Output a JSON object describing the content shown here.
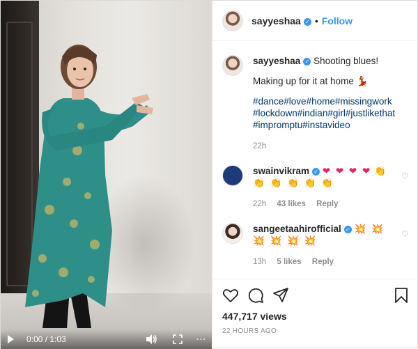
{
  "post": {
    "username": "sayyeshaa",
    "follow_label": "Follow",
    "separator": "•"
  },
  "caption": {
    "username": "sayyeshaa",
    "line1": "Shooting blues!",
    "line2": "Making up for it at home",
    "hashtags": "#dance#love#home#missingwork#lockdown#indian#girl#justlikethat#impromptu#instavideo",
    "time": "22h"
  },
  "comments": [
    {
      "username": "swainvikram",
      "emoji_hearts": "❤ ❤ ❤ ❤",
      "emoji_claps": "👏 👏 👏 👏 👏 👏",
      "time": "22h",
      "likes": "43 likes",
      "reply": "Reply"
    },
    {
      "username": "sangeetaahirofficial",
      "emoji_bursts": "💥 💥 💥 💥 💥 💥",
      "time": "13h",
      "likes": "5 likes",
      "reply": "Reply"
    }
  ],
  "footer": {
    "views": "447,717 views",
    "posted": "22 HOURS AGO"
  },
  "video": {
    "time": "0:00 / 1:03"
  },
  "icons": {
    "like": "heart-icon",
    "comment": "comment-icon",
    "share": "share-icon",
    "save": "bookmark-icon",
    "verified": "verified-badge-icon"
  },
  "colors": {
    "link": "#3897f0",
    "hashtag": "#00376b",
    "muted": "#8e8e8e"
  }
}
